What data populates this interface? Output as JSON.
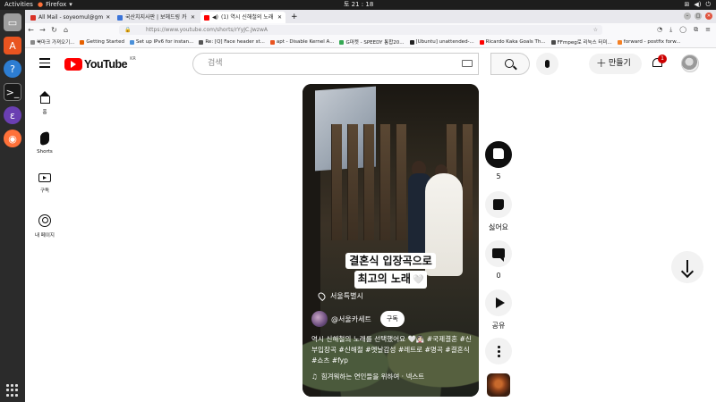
{
  "system": {
    "activities": "Activities",
    "app_name": "Firefox",
    "clock": "토 21 : 18"
  },
  "browser": {
    "tabs": [
      {
        "label": "All Mail - soyeomul@gm",
        "favicon_color": "#d93025"
      },
      {
        "label": "국산치지사판 | 보헤드링 카",
        "favicon_color": "#3b74d9"
      },
      {
        "label": "(1) 역시 신해철의 노래",
        "favicon_color": "#ff0000",
        "active": true
      }
    ],
    "new_tab": "+",
    "url": "https://www.youtube.com/shorts/rYyJC.JwzwA",
    "bookmarks": [
      {
        "label": "북마크 가져오기...",
        "favicon_color": "#888888"
      },
      {
        "label": "Getting Started",
        "favicon_color": "#e66000"
      },
      {
        "label": "Set up IPv6 for instan...",
        "favicon_color": "#4a90d9"
      },
      {
        "label": "Re: [Q] Face header st...",
        "favicon_color": "#555555"
      },
      {
        "label": "apt - Disable Kernel A...",
        "favicon_color": "#e95420"
      },
      {
        "label": "G마켓 - SPEEDY 통합20...",
        "favicon_color": "#35a853"
      },
      {
        "label": "[Ubuntu] unattended-...",
        "favicon_color": "#222222"
      },
      {
        "label": "Ricardo Kaka Goals Th...",
        "favicon_color": "#ff0000"
      },
      {
        "label": "FFmpeg로 리눅스 터미...",
        "favicon_color": "#4a4a4a"
      },
      {
        "label": "forward - postfix forw...",
        "favicon_color": "#f48024"
      }
    ]
  },
  "youtube": {
    "logo_text": "YouTube",
    "region": "KR",
    "search_placeholder": "검색",
    "create_label": "만들기",
    "notification_count": "1",
    "guide": [
      {
        "label": "홈",
        "icon": "home-icon"
      },
      {
        "label": "Shorts",
        "icon": "shorts-icon"
      },
      {
        "label": "구독",
        "icon": "subscriptions-icon"
      },
      {
        "label": "내 페이지",
        "icon": "you-icon"
      }
    ],
    "short": {
      "caption_line1": "결혼식 입장곡으로",
      "caption_line2": "최고의 노래",
      "caption_emoji": "🤍",
      "location": "서울특별시",
      "channel": "@서울카세트",
      "subscribe": "구독",
      "description": "역시 신해철의 노래를 선택했어요 🤍👰🏻 #국제결혼 #신부입장곡 #신해철 #옛날감성 #레트로 #명곡 #결혼식 #쇼츠 #fyp",
      "music": "힘겨워하는 연인들을 위하여 · 넥스트"
    },
    "actions": {
      "like_count": "5",
      "dislike_label": "싫어요",
      "comment_count": "0",
      "share_label": "공유"
    }
  }
}
